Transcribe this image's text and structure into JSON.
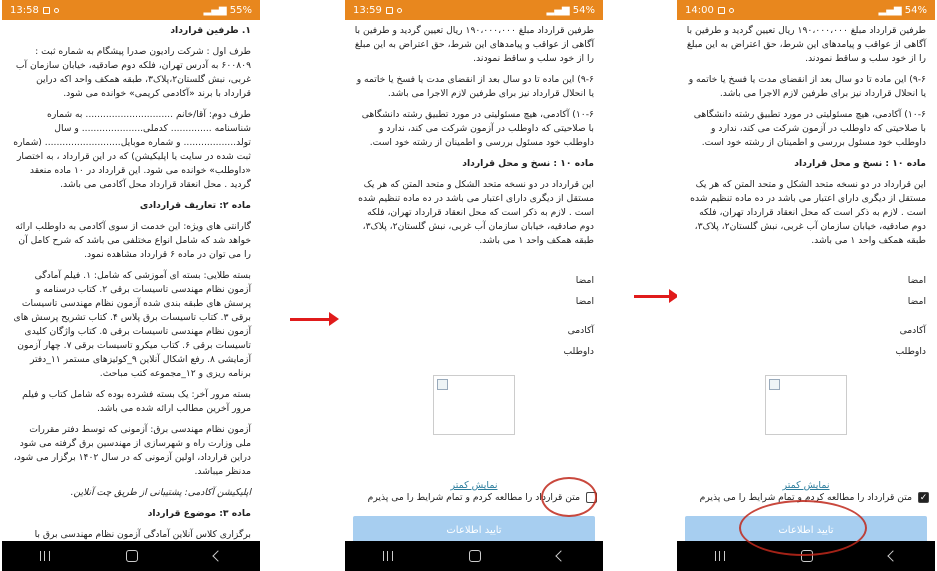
{
  "screens": [
    {
      "status_time": "13:58",
      "status_right": "55%",
      "header_line": "۱. طرفین قرارداد",
      "paragraphs": [
        {
          "t": "طرف اول : شرکت رادیون صدرا پیشگام به شماره ثبت : ۶۰۰۸۰۹ به آدرس تهران، فلکه دوم صادقیه، خیابان سازمان آب غربی، نبش گلستان۲،پلاک۳، طبقه همکف واحد اکه دراین قرارداد با برند «آکادمی کریمی» خوانده می شود.",
          "c": ""
        },
        {
          "t": "طرف دوم: آقا/خانم .............................. به شماره شناسنامه .............. کدملی..................... و سال تولد.................. و شماره موبایل.......................... (شماره ثبت شده در سایت یا اپلیکیشن) که در این قرارداد ، به اختصار «داوطلب» خوانده می شود. این قرارداد در ۱۰ ماده منعقد گردید . محل انعقاد قرارداد محل آکادمی می باشد.",
          "c": ""
        },
        {
          "t": "ماده ۲: تعاریف قراردادی",
          "c": "h"
        },
        {
          "t": "گارانتی های ویژه: این خدمت از سوی آکادمی به داوطلب ارائه خواهد شد که شامل انواع مختلفی می باشد که شرح کامل آن را می توان در ماده ۶ قرارداد مشاهده نمود.",
          "c": ""
        },
        {
          "t": "بسته طلایی: بسته ای آموزشی که شامل: ۱. فیلم آمادگی آزمون نظام مهندسی تاسیسات برقی ۲. کتاب درسنامه و پرسش های طبقه بندی شده آزمون نظام مهندسی تاسیسات برقی ۳. کتاب تاسیسات برق پلاس ۴. کتاب تشریح پرسش های آزمون نظام مهندسی تاسیسات برقی ۵. کتاب واژگان کلیدی تاسیسات برقی ۶. کتاب میکرو تاسیسات برقی ۷. چهار آزمون آزمایشی ۸. رفع اشکال آنلاین ۹_کوئیزهای مستمر ۱۱_دفتر برنامه ریزی و ۱۲_مجموعه کتب مباحث.",
          "c": ""
        },
        {
          "t": "بسته مرور آخر: یک بسته فشرده بوده که شامل کتاب و فیلم مرور آخرین مطالب ارائه شده می باشد.",
          "c": ""
        },
        {
          "t": "آزمون نظام مهندسی برق: آزمونی که توسط دفتر مقررات ملی وزارت راه و شهرسازی از مهندسین برق گرفته می شود دراین قرارداد، اولین آزمونی که در سال ۱۴۰۲ برگزار می شود، مدنظر میباشد.",
          "c": ""
        },
        {
          "t": "اپلیکیشن آکادمی: پشتیبانی از طریق چت آنلاین.",
          "c": "i"
        },
        {
          "t": "ماده ۳: موضوع قرارداد",
          "c": "h"
        },
        {
          "t": "برگزاری کلاس آنلاین آمادگی آزمون نظام مهندسی برق با",
          "c": ""
        }
      ]
    },
    {
      "status_time": "13:59",
      "status_right": "54%",
      "paragraphs": [
        {
          "t": "طرفین قرارداد مبلغ ۱۹۰،۰۰۰،۰۰۰ ریال تعیین گردید و طرفین با آگاهی از عواقب و پیامدهای این شرط، حق اعتراض به این مبلغ را از خود سلب و ساقط نمودند.",
          "c": ""
        },
        {
          "t": "۹-۶) این ماده تا دو سال بعد از انقضای مدت یا فسخ یا خاتمه و یا انحلال قرارداد نیز برای طرفین لازم الاجرا می باشد.",
          "c": ""
        },
        {
          "t": "۱۰-۶) آکادمی، هیچ مسئولیتی در مورد تطبیق رشته دانشگاهی با صلاحیتی که داوطلب در آزمون شرکت می کند، ندارد و داوطلب خود مسئول بررسی و اطمینان از رشته خود است.",
          "c": ""
        },
        {
          "t": "ماده ۱۰ : نسخ و محل قرارداد",
          "c": "h"
        },
        {
          "t": "این قرارداد در دو نسخه متحد الشکل و متحد المتن که هر یک مستقل از دیگری دارای اعتبار می باشد در ده ماده تنظیم شده است . لازم به ذکر است که محل انعقاد قرارداد تهران، فلکه دوم صادقیه، خیابان سازمان آب غربی، نبش گلستان۲، پلاک۳، طبقه همکف واحد ۱ می باشد.",
          "c": ""
        }
      ]
    },
    {
      "status_time": "14:00",
      "status_right": "54%",
      "paragraphs": [
        {
          "t": "طرفین قرارداد مبلغ ۱۹۰،۰۰۰،۰۰۰ ریال تعیین گردید و طرفین با آگاهی از عواقب و پیامدهای این شرط، حق اعتراض به این مبلغ را از خود سلب و ساقط نمودند.",
          "c": ""
        },
        {
          "t": "۹-۶) این ماده تا دو سال بعد از انقضای مدت یا فسخ یا خاتمه و یا انحلال قرارداد نیز برای طرفین لازم الاجرا می باشد.",
          "c": ""
        },
        {
          "t": "۱۰-۶) آکادمی، هیچ مسئولیتی در مورد تطبیق رشته دانشگاهی با صلاحیتی که داوطلب در آزمون شرکت می کند، ندارد و داوطلب خود مسئول بررسی و اطمینان از رشته خود است.",
          "c": ""
        },
        {
          "t": "ماده ۱۰ : نسخ و محل قرارداد",
          "c": "h"
        },
        {
          "t": "این قرارداد در دو نسخه متحد الشکل و متحد المتن که هر یک مستقل از دیگری دارای اعتبار می باشد در ده ماده تنظیم شده است . لازم به ذکر است که محل انعقاد قرارداد تهران، فلکه دوم صادقیه، خیابان سازمان آب غربی، نبش گلستان۲، پلاک۳، طبقه همکف واحد ۱ می باشد.",
          "c": ""
        }
      ]
    }
  ],
  "signatures": {
    "sign1": "امضا",
    "sign2": "امضا",
    "academy": "آکادمی",
    "candidate": "داوطلب"
  },
  "show_less": "نمایش کمتر",
  "agree_text": "متن قرارداد را مطالعه کردم و تمام شرایط را می پذیرم",
  "confirm_label": "تایید اطلاعات",
  "agree_checked": [
    false,
    true
  ],
  "colors": {
    "status_bar": "#e8871e",
    "confirm_bg": "#a7cef0",
    "link": "#2a7c9c",
    "arrow": "#e01b1b",
    "annotation": "#c0281b"
  }
}
